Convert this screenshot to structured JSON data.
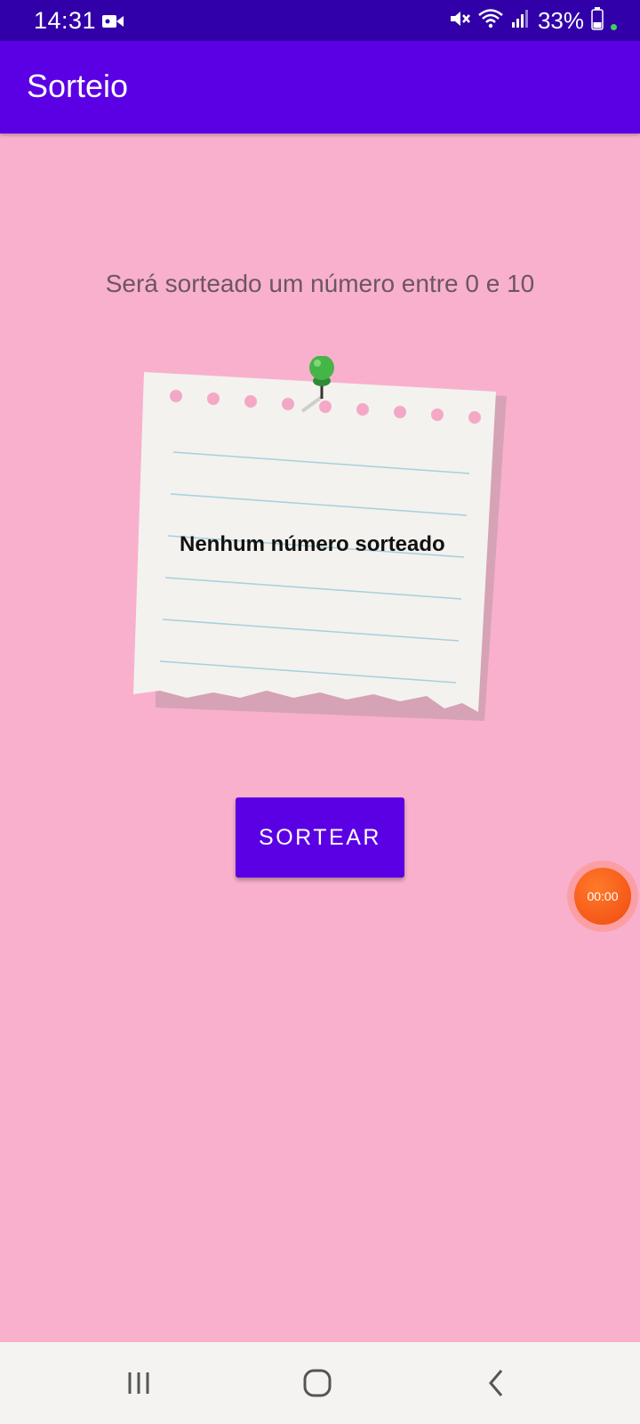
{
  "status_bar": {
    "time": "14:31",
    "battery_percent": "33%",
    "icons": [
      "video-recording-icon",
      "mute-icon",
      "wifi-icon",
      "signal-icon",
      "battery-icon"
    ]
  },
  "app_bar": {
    "title": "Sorteio",
    "color": "#5b00e5"
  },
  "main": {
    "instruction": "Será sorteado um número entre 0 e 10",
    "result_text": "Nenhum número sorteado",
    "draw_button_label": "SORTEAR",
    "background_color": "#f9b0cc"
  },
  "overlay": {
    "timer": "00:00"
  },
  "nav_bar": {
    "buttons": [
      "recent-apps-icon",
      "home-icon",
      "back-icon"
    ]
  }
}
